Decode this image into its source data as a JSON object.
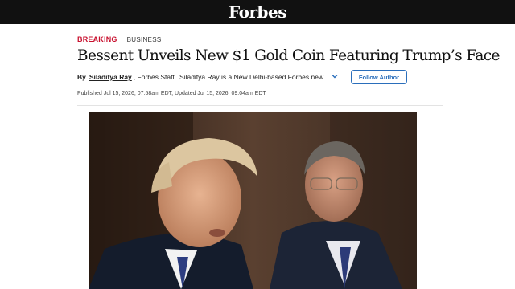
{
  "site": {
    "logo": "Forbes"
  },
  "article": {
    "kicker_breaking": "BREAKING",
    "kicker_section": "BUSINESS",
    "headline": "Bessent Unveils New $1 Gold Coin Featuring Trump’s Face",
    "byline_by": "By",
    "author": "Siladitya Ray",
    "author_role": ", Forbes Staff.",
    "author_desc": "Siladitya Ray is a New Delhi-based Forbes new...",
    "follow_label": "Follow Author",
    "published": "Published Jul 15, 2026, 07:58am EDT, Updated Jul 15, 2026, 09:04am EDT"
  },
  "icons": {
    "expand": "chevron-down-icon"
  },
  "colors": {
    "topbar": "#111111",
    "breaking": "#c8102e",
    "follow": "#2a6ebb"
  }
}
